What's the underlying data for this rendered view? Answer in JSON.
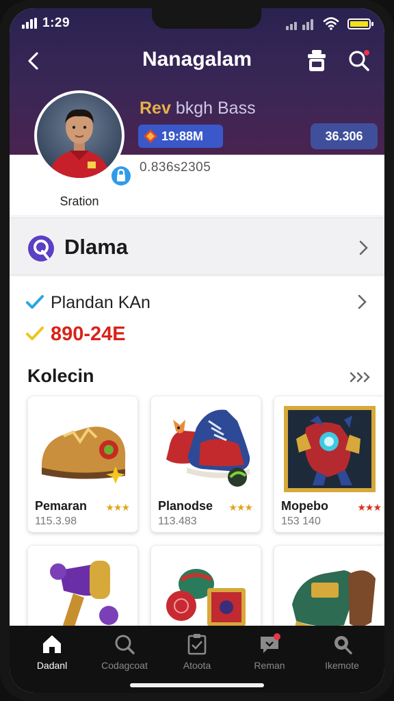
{
  "status": {
    "time": "1:29"
  },
  "header": {
    "title": "Nanagalam"
  },
  "profile": {
    "name_bold": "Rev",
    "name_rest": "bkgh Bass",
    "subtitle": "Sration",
    "stat_a": "19:88M",
    "stat_b": "36.306",
    "code": "0.836s2305"
  },
  "menu": {
    "dlama_label": "Dlama"
  },
  "plan": {
    "label": "Plandan KAn",
    "code": "890-24E"
  },
  "collection": {
    "title": "Kolecin",
    "items": [
      {
        "name": "Pemaran",
        "stars": "★★★",
        "value": "115.3.98"
      },
      {
        "name": "Planodse",
        "stars": "★★★",
        "value": "113.483"
      },
      {
        "name": "Mopebo",
        "stars": "★★★",
        "value": "153 140"
      }
    ]
  },
  "nav": {
    "items": [
      {
        "label": "Dadanl",
        "icon": "home-icon"
      },
      {
        "label": "Codagcoat",
        "icon": "search-icon"
      },
      {
        "label": "Atoota",
        "icon": "clipboard-icon"
      },
      {
        "label": "Reman",
        "icon": "chat-icon"
      },
      {
        "label": "Ikemote",
        "icon": "magnifier-icon"
      }
    ]
  },
  "colors": {
    "header": "#3a2756",
    "accent_blue": "#3a58c9",
    "code_red": "#d8231a",
    "star_gold": "#e2a51e"
  }
}
